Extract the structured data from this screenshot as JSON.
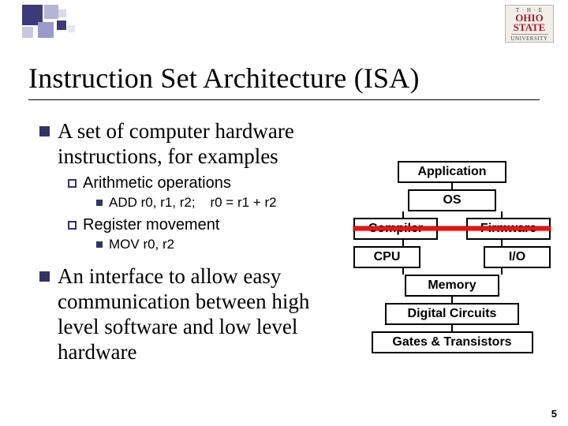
{
  "logo": {
    "top": "T · H · E",
    "main_line1": "OHIO",
    "main_line2": "STATE",
    "sub": "UNIVERSITY"
  },
  "title": "Instruction Set Architecture (ISA)",
  "bullets": {
    "b1": "A set of computer hardware instructions, for examples",
    "b1a": "Arithmetic operations",
    "b1a_i": "ADD r0, r1, r2;    r0 = r1 + r2",
    "b1b": "Register movement",
    "b1b_i": "MOV r0, r2",
    "b2": "An interface to allow easy communication between high level software and low level hardware"
  },
  "diagram": {
    "application": "Application",
    "os": "OS",
    "compiler": "Compiler",
    "firmware": "Firmware",
    "cpu": "CPU",
    "io": "I/O",
    "memory": "Memory",
    "digital": "Digital Circuits",
    "gates": "Gates & Transistors"
  },
  "pagenum": "5"
}
